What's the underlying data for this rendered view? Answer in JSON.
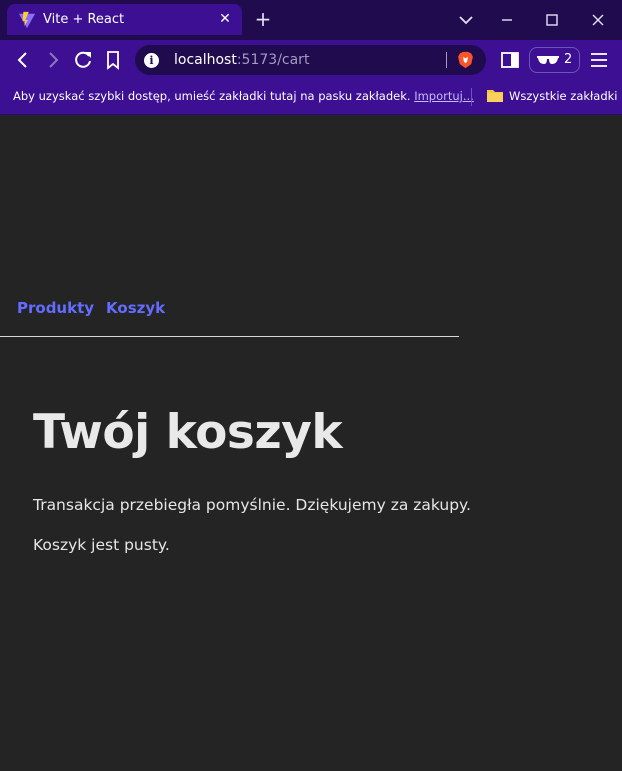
{
  "browser": {
    "tab": {
      "title": "Vite + React"
    },
    "address_bar": {
      "host": "localhost",
      "path": ":5173/cart"
    },
    "wallet_badge_count": "2",
    "bookmarks_bar": {
      "message": "Aby uzyskać szybki dostęp, umieść zakładki tutaj na pasku zakładek.",
      "import_link": "Importuj...",
      "all_bookmarks": "Wszystkie zakładki"
    },
    "icons": [
      "vite-logo-icon",
      "close-icon",
      "plus-icon",
      "chevron-down-icon",
      "minimize-icon",
      "maximize-icon",
      "close-window-icon",
      "back-arrow-icon",
      "forward-arrow-icon",
      "reload-icon",
      "bookmark-icon",
      "info-icon",
      "brave-shield-icon",
      "sidebar-icon",
      "wallet-glasses-icon",
      "menu-icon",
      "folder-icon"
    ]
  },
  "app": {
    "nav": {
      "products": "Produkty",
      "cart": "Koszyk"
    },
    "heading": "Twój koszyk",
    "success_message": "Transakcja przebiegła pomyślnie. Dziękujemy za zakupy.",
    "empty_message": "Koszyk jest pusty."
  },
  "colors": {
    "link": "#646cff",
    "background": "#242424",
    "browser_purple": "#3c0f93",
    "tabstrip": "#1f0b4d"
  }
}
